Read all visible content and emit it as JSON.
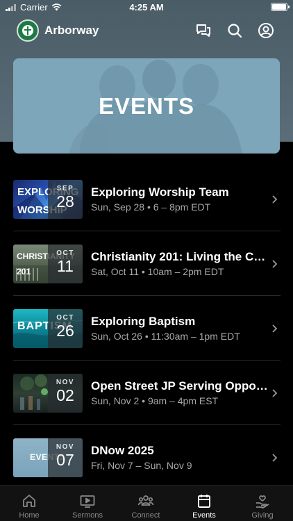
{
  "status_bar": {
    "carrier": "Carrier",
    "time": "4:25 AM"
  },
  "header": {
    "app_name": "Arborway"
  },
  "hero": {
    "title": "EVENTS"
  },
  "events": [
    {
      "thumb_text": "EXPLORING WORSHIP",
      "month": "SEP",
      "day": "28",
      "title": "Exploring Worship Team",
      "subtitle": "Sun, Sep 28 • 6 – 8pm EDT"
    },
    {
      "thumb_text": "CHRISTIANITY 201",
      "month": "OCT",
      "day": "11",
      "title": "Christianity 201: Living the Ch...",
      "subtitle": "Sat, Oct 11 • 10am – 2pm EDT"
    },
    {
      "thumb_text": "BAPTISM",
      "month": "OCT",
      "day": "26",
      "title": "Exploring Baptism",
      "subtitle": "Sun, Oct 26 • 11:30am – 1pm EDT"
    },
    {
      "thumb_text": "",
      "month": "NOV",
      "day": "02",
      "title": "Open Street JP Serving Oppor...",
      "subtitle": "Sun, Nov 2 • 9am – 4pm EST"
    },
    {
      "thumb_text": "EVENTS",
      "month": "NOV",
      "day": "07",
      "title": "DNow 2025",
      "subtitle": "Fri, Nov 7 – Sun, Nov 9"
    }
  ],
  "tabs": [
    {
      "label": "Home",
      "icon": "home-icon",
      "active": false
    },
    {
      "label": "Sermons",
      "icon": "play-icon",
      "active": false
    },
    {
      "label": "Connect",
      "icon": "people-icon",
      "active": false
    },
    {
      "label": "Events",
      "icon": "calendar-icon",
      "active": true
    },
    {
      "label": "Giving",
      "icon": "heart-hand-icon",
      "active": false
    }
  ],
  "colors": {
    "background": "#000000",
    "header_bg": "#4f616b",
    "hero_bg": "#7ea6bb",
    "muted_text": "#a9a9a9",
    "tab_inactive": "#8a8a8a"
  }
}
